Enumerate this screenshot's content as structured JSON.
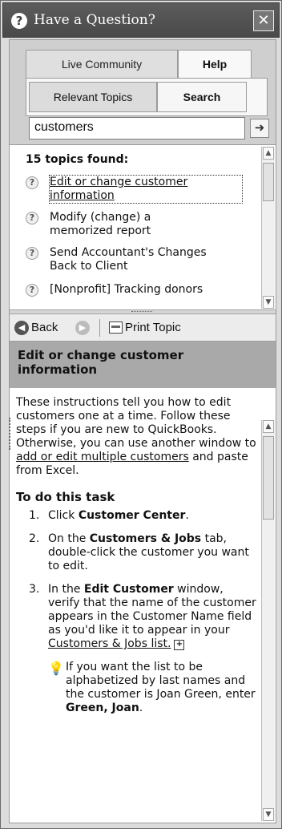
{
  "window": {
    "title": "Have a Question?",
    "close_glyph": "✕",
    "help_glyph": "?"
  },
  "tabs": {
    "live_community": "Live Community",
    "help": "Help"
  },
  "subtabs": {
    "relevant_topics": "Relevant Topics",
    "search": "Search"
  },
  "search": {
    "value": "customers",
    "go_glyph": "➜"
  },
  "topics": {
    "count_label": "15 topics found:",
    "items": [
      {
        "line1": "Edit or change customer",
        "line2": "information"
      },
      {
        "line1": "Modify (change) a",
        "line2": "memorized report"
      },
      {
        "line1": "Send Accountant's Changes",
        "line2": "Back to Client"
      },
      {
        "line1": "[Nonprofit] Tracking donors",
        "line2": ""
      }
    ]
  },
  "toolbar": {
    "back": "Back",
    "print_topic": "Print Topic"
  },
  "article": {
    "title_line1": "Edit or change customer",
    "title_line2": "information",
    "intro_1": "These instructions tell you how to edit customers one at a time. Follow these steps if you are new to QuickBooks. Otherwise, you can use another window to ",
    "intro_link": "add or edit multiple customers",
    "intro_2": " and paste from Excel.",
    "task_heading": "To do this task",
    "step1_num": "1.",
    "step1_a": "Click ",
    "step1_b": "Customer Center",
    "step1_c": ".",
    "step2_num": "2.",
    "step2_a": "On the ",
    "step2_b": "Customers & Jobs",
    "step2_c": " tab, double-click the customer you want to edit.",
    "step3_num": "3.",
    "step3_a": "In the ",
    "step3_b": "Edit Customer",
    "step3_c": " window, verify that the name of the customer appears in the Customer Name field as you'd like it to appear in your ",
    "step3_link": "Customers & Jobs list.",
    "expand_glyph": "+",
    "tip_a": "If you want the list to be alphabetized by last names and the customer is Joan Green, enter ",
    "tip_b": "Green, Joan",
    "tip_c": "."
  }
}
